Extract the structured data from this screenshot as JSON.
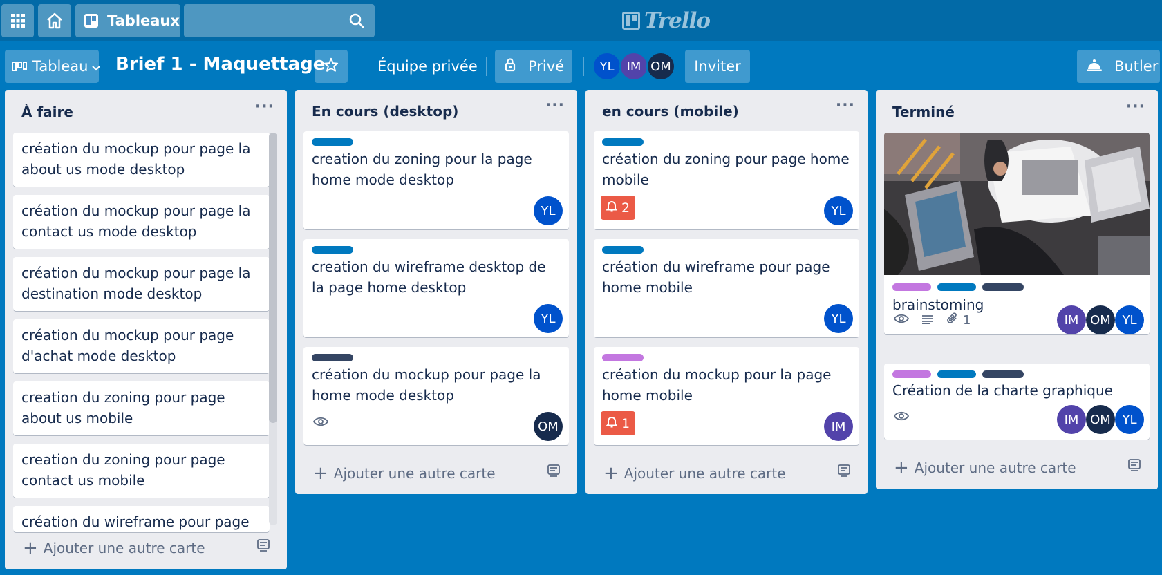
{
  "topbar": {
    "apps_icon": "grid-icon",
    "home_icon": "home-icon",
    "boards_label": "Tableaux",
    "search_placeholder": "",
    "logo_text": "Trello"
  },
  "board": {
    "view_label": "Tableau",
    "title": "Brief 1 - Maquettage",
    "team_label": "Équipe privée",
    "visibility_label": "Privé",
    "members": [
      "YL",
      "IM",
      "OM"
    ],
    "invite_label": "Inviter",
    "butler_label": "Butler"
  },
  "colors": {
    "board_bg": "#0079bf",
    "topbar_bg": "#026aa7",
    "label_blue": "#0079bf",
    "label_navy": "#344563",
    "label_purple": "#c377e0",
    "badge_red": "#eb5a46",
    "avatar_yl": "#0052cc",
    "avatar_im": "#5243aa",
    "avatar_om": "#172b4d"
  },
  "lists": [
    {
      "title": "À faire",
      "add_label": "Ajouter une autre carte",
      "cards": [
        {
          "text": "création du mockup pour page la about us mode desktop"
        },
        {
          "text": "création du mockup pour page la contact us mode desktop"
        },
        {
          "text": "création du mockup pour page la destination mode desktop"
        },
        {
          "text": "création du mockup pour page d'achat mode desktop"
        },
        {
          "text": "creation du zoning pour page about us mobile"
        },
        {
          "text": "creation du zoning pour page contact us mobile"
        },
        {
          "text": "création du wireframe pour page"
        }
      ]
    },
    {
      "title": "En cours (desktop)",
      "add_label": "Ajouter une autre carte",
      "cards": [
        {
          "text": "creation du zoning pour la page home mode desktop",
          "member": "YL"
        },
        {
          "text": "creation du wireframe desktop de la page home desktop",
          "member": "YL"
        },
        {
          "text": "création du mockup pour page la home mode desktop",
          "member": "OM"
        }
      ]
    },
    {
      "title": "en cours (mobile)",
      "add_label": "Ajouter une autre carte",
      "cards": [
        {
          "text": "création du zoning pour page home mobile",
          "member": "YL",
          "alerts": "2"
        },
        {
          "text": "création du wireframe pour page home mobile",
          "member": "YL"
        },
        {
          "text": "création du mockup pour la page home mobile",
          "member": "IM",
          "alerts": "1"
        }
      ]
    },
    {
      "title": "Terminé",
      "add_label": "Ajouter une autre carte",
      "cards": [
        {
          "text": "brainstoming",
          "attachments": "1",
          "members": [
            "IM",
            "OM",
            "YL"
          ]
        },
        {
          "text": "Création de la charte graphique",
          "members": [
            "IM",
            "OM",
            "YL"
          ]
        }
      ]
    }
  ]
}
